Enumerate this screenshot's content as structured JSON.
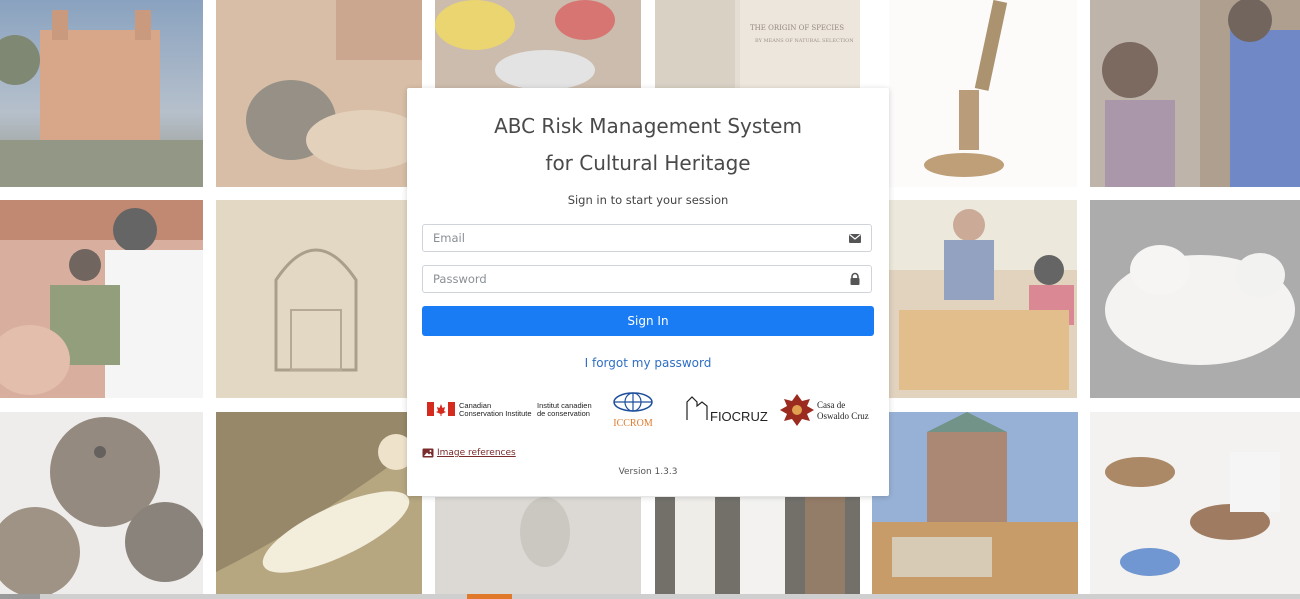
{
  "login": {
    "title_line1": "ABC Risk Management System",
    "title_line2": "for Cultural Heritage",
    "subtitle": "Sign in to start your session",
    "email_placeholder": "Email",
    "password_placeholder": "Password",
    "sign_in_label": "Sign In",
    "forgot_link": "I forgot my password",
    "image_references_link": "Image references",
    "version": "Version 1.3.3"
  },
  "logos": {
    "cci_en_line1": "Canadian",
    "cci_en_line2": "Conservation Institute",
    "cci_fr_line1": "Institut canadien",
    "cci_fr_line2": "de conservation",
    "iccrom": "ICCROM",
    "fiocruz": "FIOCRUZ",
    "casa_line1": "Casa de",
    "casa_line2": "Oswaldo Cruz"
  },
  "background": {
    "book_text_line1": "THE ORIGIN OF SPECIES",
    "book_text_line2": "BY MEANS OF NATURAL SELECTION"
  },
  "colors": {
    "primary": "#1a7cf5",
    "link": "#2f6fc5",
    "canada_red": "#d52b1e",
    "iccrom_blue": "#1d4f9b",
    "casa_red": "#9b2b1f"
  },
  "icons": {
    "email": "envelope-icon",
    "password": "lock-icon",
    "image_references": "image-icon"
  }
}
